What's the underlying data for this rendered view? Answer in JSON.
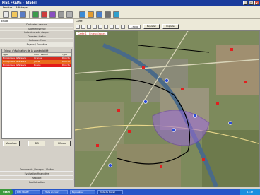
{
  "window": {
    "title": "RISK FRAME - [Etude]",
    "controls": [
      "_",
      "□",
      "×"
    ]
  },
  "menu": [
    "Fenêtre",
    "Affichage"
  ],
  "toolbar_icons": [
    "new-file-icon",
    "open-folder-icon",
    "save-icon",
    "layers-icon",
    "color-palette-icon",
    "book-icon",
    "print-icon",
    "copy-icon",
    "globe-icon",
    "export-icon",
    "help-icon",
    "settings-icon",
    "info-icon"
  ],
  "left_panel": {
    "title": "Etude",
    "nav_items": [
      "Contextes de crue",
      "Bâtiments type",
      "Indicateurs de risques",
      "Données trafics",
      "Hauteurs d'eau",
      "Enjeux / Données"
    ],
    "affect_header": "Enjeux d'évaluation de la vulnérabilité",
    "table": {
      "columns": [
        "Type",
        "Nom / Libellé",
        "Type"
      ],
      "rows": [
        {
          "c1": "Entreprises Référence",
          "c2": "Orange",
          "c3": "Directe"
        },
        {
          "c1": "Entreprises Référence",
          "c2": "Jaune",
          "c3": "Directe"
        },
        {
          "c1": "Entreprises Référence",
          "c2": "Rouge",
          "c3": "Directe"
        }
      ]
    },
    "buttons": {
      "visualiser": "Visualiser",
      "sig": "SIG",
      "effacer": "Effacer"
    },
    "bottom_nav": [
      "Documents / Images / Vidéos",
      "Evaluation financière",
      "Rapport",
      "Capitalisation"
    ]
  },
  "map": {
    "header": "Carte",
    "scale": "1:3000",
    "export_label": "Exporter",
    "import_label": "Importer",
    "tab_label": "Carte 1 : Enjeux/zones"
  },
  "taskbar": {
    "start": "Start",
    "tasks": [
      "RISK FRAME",
      "Etude en cours",
      "Explorateur",
      "Poste de travail"
    ],
    "clock": "14:47"
  }
}
